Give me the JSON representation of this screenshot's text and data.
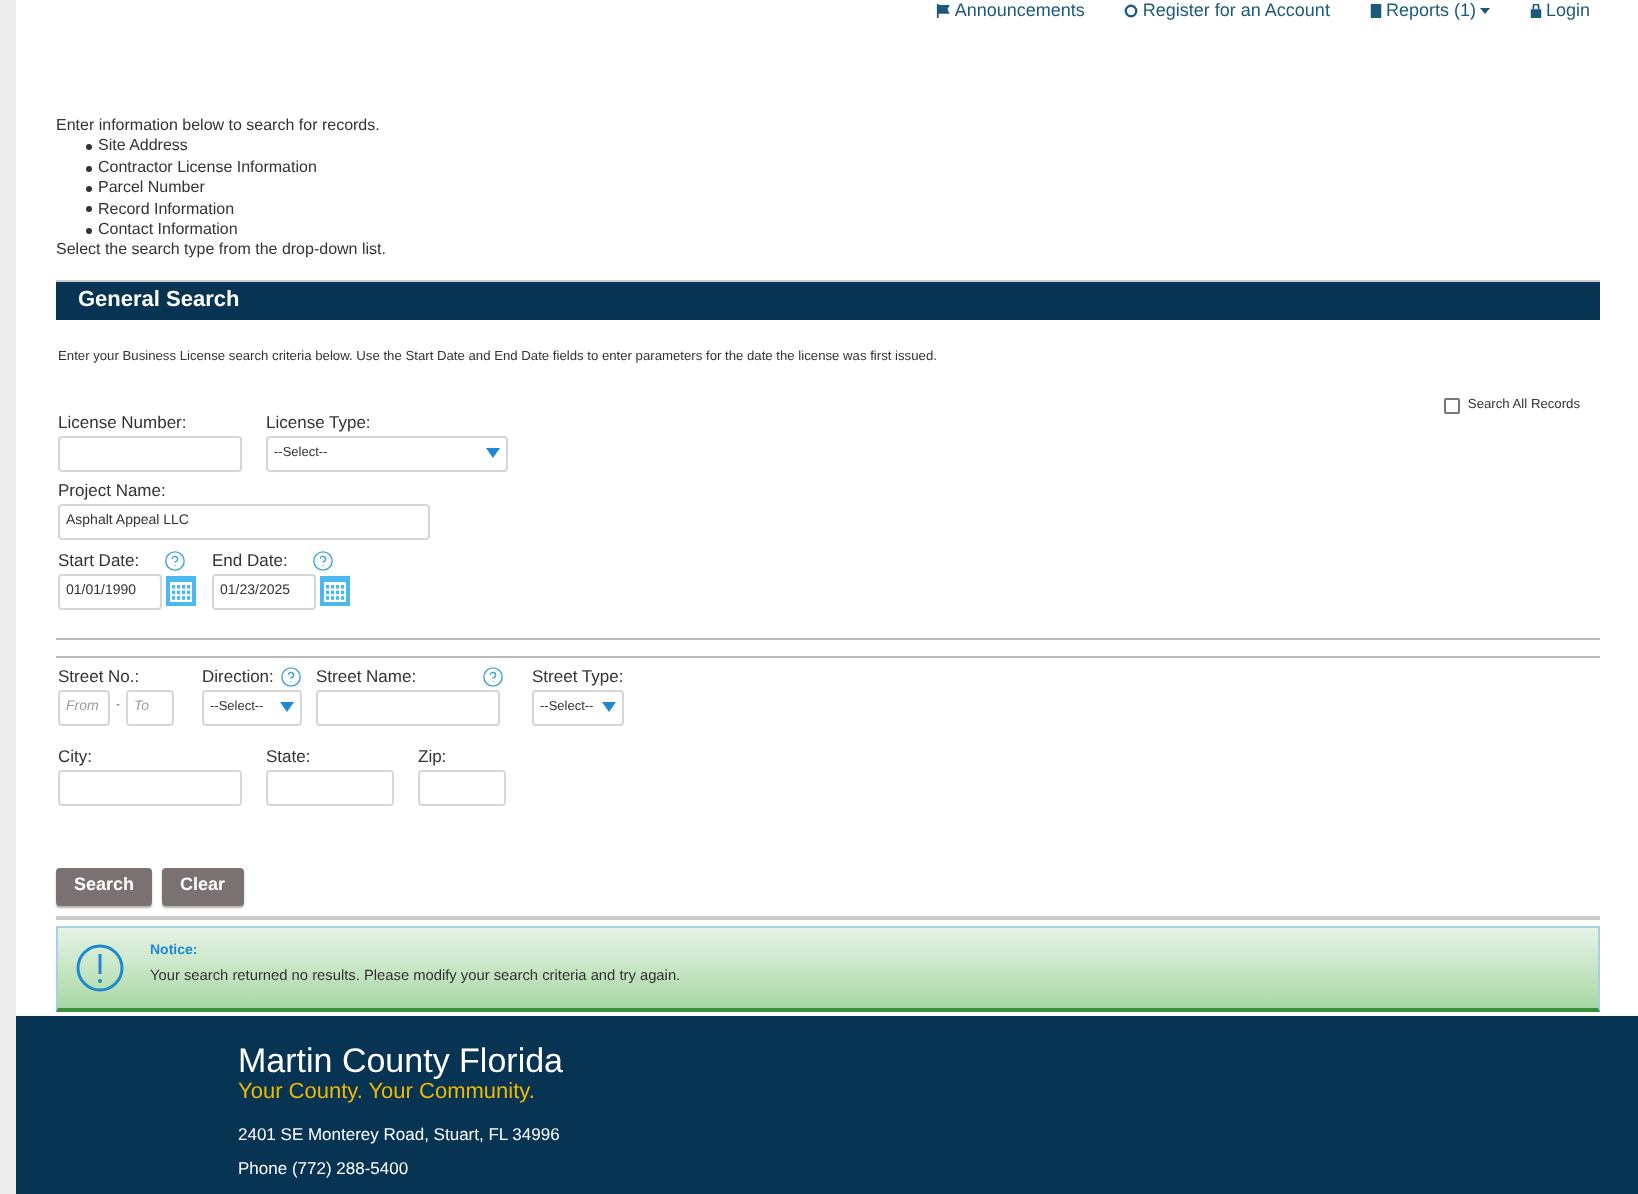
{
  "top_nav": [
    {
      "label": "Announcements"
    },
    {
      "label": "Register for an Account"
    },
    {
      "label": "Reports (1)",
      "dropdown": true
    },
    {
      "label": "Login"
    }
  ],
  "intro": {
    "lead": "Enter information below to search for records.",
    "items": [
      "Site Address",
      "Contractor License Information",
      "Parcel Number",
      "Record Information",
      "Contact Information"
    ],
    "tail": "Select the search type from the drop-down list."
  },
  "section": {
    "title": "General Search",
    "description": "Enter your Business License search criteria below.  Use the Start Date and End Date fields to enter parameters for the date the license was first issued."
  },
  "search_all": {
    "label": "Search All Records",
    "checked": false
  },
  "license_number": {
    "label": "License Number:"
  },
  "license_type": {
    "label": "License Type:",
    "value": "--Select--"
  },
  "project_name": {
    "label": "Project Name:",
    "value": "Asphalt Appeal LLC"
  },
  "start_date": {
    "label": "Start Date:",
    "value": "01/01/1990"
  },
  "end_date": {
    "label": "End Date:",
    "value": "01/23/2025"
  },
  "street_no": {
    "label": "Street No.:",
    "from_placeholder": "From",
    "separator": "-",
    "to_placeholder": "To"
  },
  "direction": {
    "label": "Direction:",
    "value": "--Select--"
  },
  "street_name": {
    "label": "Street Name:"
  },
  "street_type": {
    "label": "Street Type:",
    "value": "--Select--"
  },
  "city": {
    "label": "City:"
  },
  "state": {
    "label": "State:"
  },
  "zip": {
    "label": "Zip:"
  },
  "buttons": [
    "Search",
    "Clear"
  ],
  "notice": {
    "title": "Notice:",
    "message": "Your search returned no results. Please modify your search criteria and try again."
  },
  "footer": {
    "name": "Martin County Florida",
    "tagline": "Your County. Your Community.",
    "address": "2401 SE Monterey Road, Stuart, FL 34996",
    "phone": "Phone (772) 288-5400"
  }
}
